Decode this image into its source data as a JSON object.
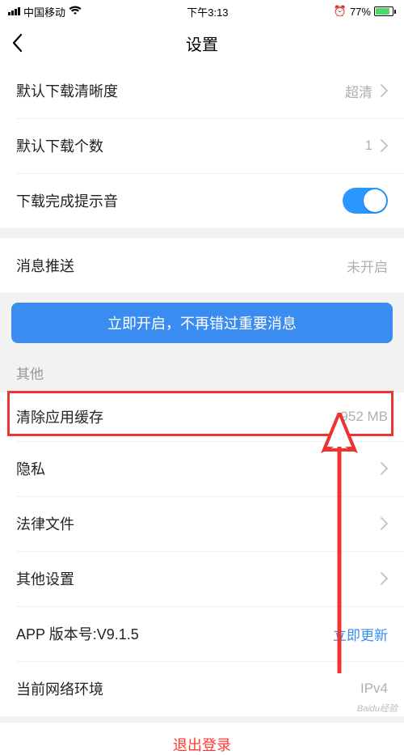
{
  "status": {
    "carrier": "中国移动",
    "time": "下午3:13",
    "battery_pct": "77%"
  },
  "nav": {
    "title": "设置"
  },
  "download": {
    "quality_label": "默认下载清晰度",
    "quality_value": "超清",
    "count_label": "默认下载个数",
    "count_value": "1",
    "sound_label": "下载完成提示音"
  },
  "push": {
    "label": "消息推送",
    "value": "未开启",
    "banner": "立即开启，不再错过重要消息"
  },
  "other": {
    "title": "其他",
    "cache_label": "清除应用缓存",
    "cache_value": "952 MB",
    "privacy_label": "隐私",
    "legal_label": "法律文件",
    "other_settings_label": "其他设置",
    "version_label": "APP 版本号:V9.1.5",
    "version_action": "立即更新",
    "network_label": "当前网络环境",
    "network_value": "IPv4"
  },
  "logout": "退出登录",
  "watermark": "Baidu经验"
}
